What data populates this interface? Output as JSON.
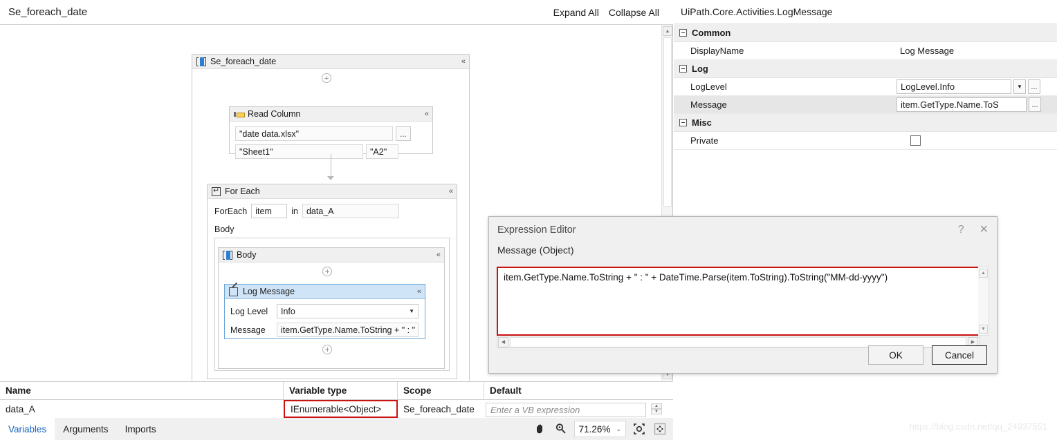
{
  "designer": {
    "breadcrumb": "Se_foreach_date",
    "expand_all_label": "Expand All",
    "collapse_all_label": "Collapse All",
    "sequence": {
      "title": "Se_foreach_date",
      "icon": "sequence-icon"
    },
    "read_column": {
      "title": "Read Column",
      "icon": "read-column-icon",
      "workbook_path": "\"date data.xlsx\"",
      "browse_label": "...",
      "sheet_name": "\"Sheet1\"",
      "range": "\"A2\""
    },
    "for_each": {
      "title": "For Each",
      "icon": "for-each-icon",
      "foreach_label": "ForEach",
      "item_value": "item",
      "in_label": "in",
      "collection_value": "data_A",
      "body_label": "Body",
      "body_sequence_title": "Body"
    },
    "log_message": {
      "title": "Log Message",
      "icon": "log-message-icon",
      "log_level_label": "Log Level",
      "log_level_value": "Info",
      "message_label": "Message",
      "message_value": "item.GetType.Name.ToString + \" : \" + D"
    }
  },
  "properties": {
    "title": "UiPath.Core.Activities.LogMessage",
    "groups": [
      {
        "name": "Common",
        "rows": [
          {
            "name": "DisplayName",
            "value": "Log Message",
            "kind": "text"
          }
        ]
      },
      {
        "name": "Log",
        "rows": [
          {
            "name": "LogLevel",
            "value": "LogLevel.Info",
            "kind": "combo"
          },
          {
            "name": "Message",
            "value": "item.GetType.Name.ToS",
            "kind": "expression"
          }
        ]
      },
      {
        "name": "Misc",
        "rows": [
          {
            "name": "Private",
            "value": "",
            "kind": "checkbox"
          }
        ]
      }
    ],
    "dots_label": "...",
    "caret_glyph": "▼"
  },
  "expression_editor": {
    "title": "Expression Editor",
    "help_glyph": "?",
    "close_glyph": "✕",
    "sub_label": "Message (Object)",
    "expression": "item.GetType.Name.ToString + \" : \" + DateTime.Parse(item.ToString).ToString(\"MM-dd-yyyy\")",
    "ok_label": "OK",
    "cancel_label": "Cancel",
    "highlight_color": "#cc1111"
  },
  "variables_panel": {
    "columns": [
      "Name",
      "Variable type",
      "Scope",
      "Default"
    ],
    "rows": [
      {
        "name": "data_A",
        "type": "IEnumerable<Object>",
        "scope": "Se_foreach_date",
        "default_placeholder": "Enter a VB expression"
      }
    ],
    "tabs": [
      {
        "label": "Variables",
        "active": true
      },
      {
        "label": "Arguments",
        "active": false
      },
      {
        "label": "Imports",
        "active": false
      }
    ],
    "type_highlight_color": "#cc1111"
  },
  "status_bar": {
    "pan_icon": "hand-icon",
    "zoom_icon": "magnifier-icon",
    "zoom_value": "71.26%",
    "zoom_caret": "⌄",
    "fit_icon": "fit-to-screen-icon",
    "overview_icon": "overview-icon"
  },
  "watermark": "https://blog.csdn.net/qq_24937551"
}
